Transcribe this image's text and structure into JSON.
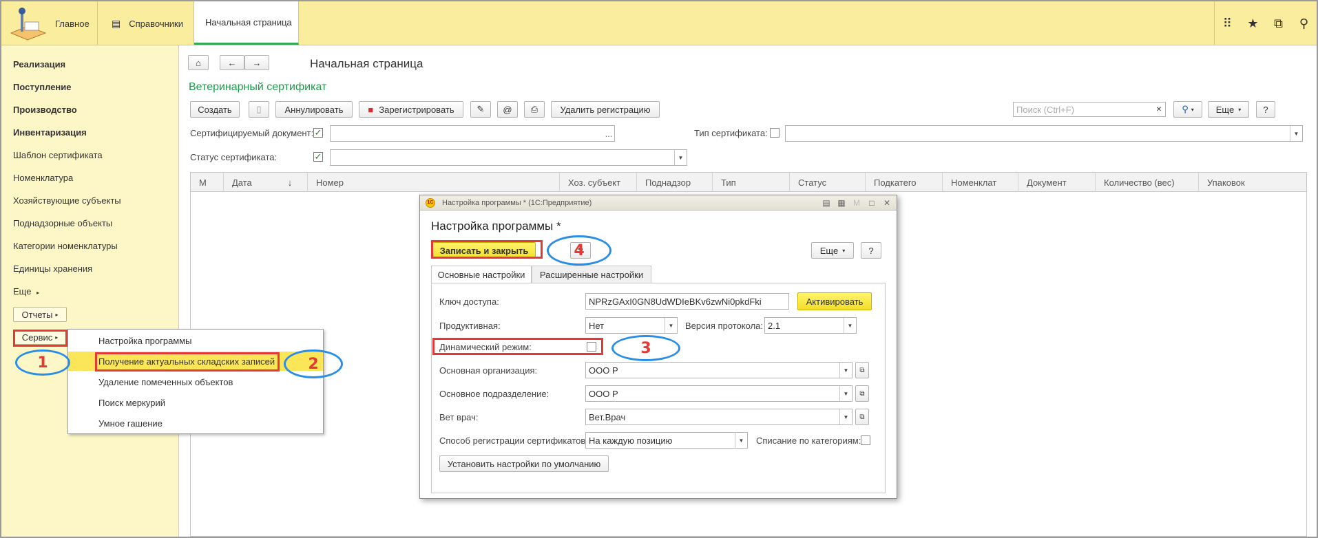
{
  "topbar": {
    "tabs": [
      {
        "label": "Главное",
        "icon": "menu-icon"
      },
      {
        "label": "Справочники",
        "icon": "list-icon"
      },
      {
        "label": "Начальная страница"
      }
    ],
    "icons": [
      "apps-grid-icon",
      "star-icon",
      "history-icon",
      "search-icon"
    ]
  },
  "sidebar": {
    "items": [
      {
        "label": "Реализация",
        "bold": true
      },
      {
        "label": "Поступление",
        "bold": true
      },
      {
        "label": "Производство",
        "bold": true
      },
      {
        "label": "Инвентаризация",
        "bold": true
      },
      {
        "label": "Шаблон сертификата"
      },
      {
        "label": "Номенклатура"
      },
      {
        "label": "Хозяйствующие субъекты"
      },
      {
        "label": "Поднадзорные объекты"
      },
      {
        "label": "Категории номенклатуры"
      },
      {
        "label": "Единицы хранения"
      }
    ],
    "more_label": "Еще",
    "reports_label": "Отчеты",
    "service_label": "Сервис"
  },
  "nav": {
    "page_title": "Начальная страница",
    "section_title": "Ветеринарный сертификат"
  },
  "toolbar": {
    "create": "Создать",
    "cancel": "Аннулировать",
    "register": "Зарегистрировать",
    "at": "@",
    "delete_registration": "Удалить регистрацию",
    "search_placeholder": "Поиск (Ctrl+F)",
    "more": "Еще",
    "help": "?"
  },
  "filters": {
    "cert_doc_label": "Сертифицируемый документ:",
    "cert_doc_checked": true,
    "cert_type_label": "Тип сертификата:",
    "cert_type_checked": false,
    "cert_status_label": "Статус сертификата:",
    "cert_status_checked": true,
    "ellipsis": "..."
  },
  "table": {
    "columns": [
      "М",
      "Дата",
      "Номер",
      "Хоз. субъект",
      "Поднадзор",
      "Тип",
      "Статус",
      "Подкатего",
      "Номенклат",
      "Документ",
      "Количество (вес)",
      "Упаковок"
    ],
    "sort_arrow": "↓"
  },
  "service_menu": {
    "items": [
      "Настройка программы",
      "Получение актуальных складских записей",
      "Удаление помеченных объектов",
      "Поиск меркурий",
      "Умное гашение"
    ]
  },
  "dialog": {
    "window_title": "Настройка программы * (1С:Предприятие)",
    "logo_text": "1С",
    "heading": "Настройка программы *",
    "save_close": "Записать и закрыть",
    "help": "?",
    "more": "Еще",
    "tabs": [
      "Основные настройки",
      "Расширенные настройки"
    ],
    "fields": {
      "access_key_label": "Ключ доступа:",
      "access_key_value": "NPRzGAxI0GN8UdWDIeBKv6zwNi0pkdFki",
      "activate": "Активировать",
      "productive_label": "Продуктивная:",
      "productive_value": "Нет",
      "protocol_label": "Версия протокола:",
      "protocol_value": "2.1",
      "dynamic_label": "Динамический режим:",
      "dynamic_checked": false,
      "org_label": "Основная организация:",
      "org_value": "ООО Р",
      "dept_label": "Основное подразделение:",
      "dept_value": "ООО Р",
      "vet_label": "Вет врач:",
      "vet_value": "Вет.Врач",
      "reg_method_label": "Способ регистрации сертификатов:",
      "reg_method_value": "На каждую позицию",
      "writeoff_label": "Списание по категориям:",
      "writeoff_checked": false,
      "defaults": "Установить настройки по умолчанию"
    }
  },
  "annotations": [
    "1",
    "2",
    "3",
    "4"
  ],
  "colors": {
    "accent_yellow": "#fbed9e",
    "sidebar": "#fdf7c7",
    "highlight": "#fbe65a",
    "section_green": "#1e9a4b",
    "annot_red": "#e53935",
    "annot_blue": "#2a8ee6"
  }
}
